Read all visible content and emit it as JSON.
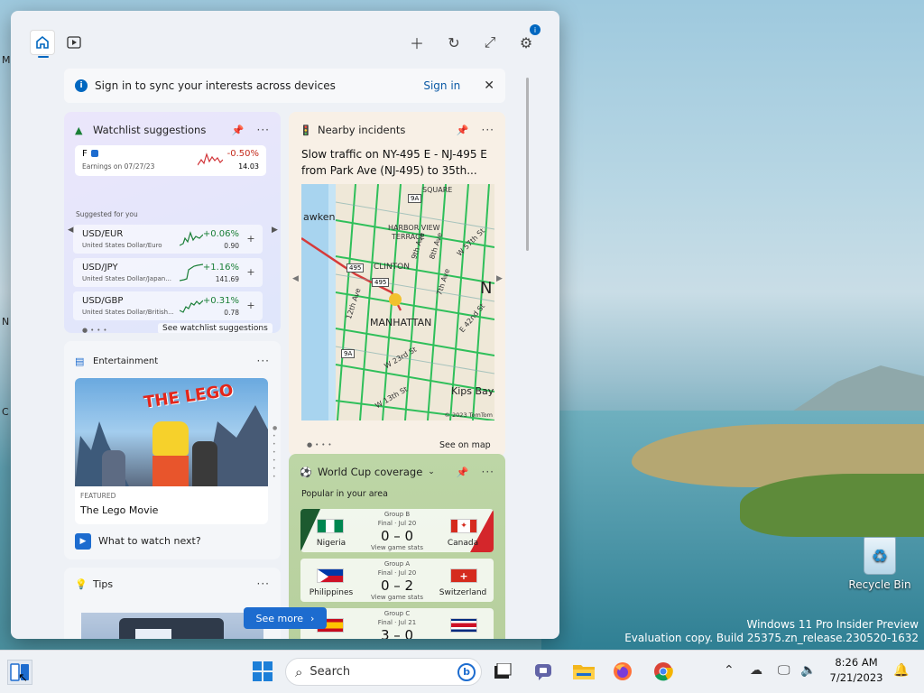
{
  "widgets_panel": {
    "sign_banner": {
      "text": "Sign in to sync your interests across devices",
      "link": "Sign in"
    },
    "watchlist": {
      "title": "Watchlist suggestions",
      "featured": {
        "symbol": "F",
        "subtitle": "Earnings on 07/27/23",
        "change": "-0.50%",
        "value": "14.03"
      },
      "suggested_label": "Suggested for you",
      "items": [
        {
          "symbol": "USD/EUR",
          "name": "United States Dollar/Euro",
          "change": "+0.06%",
          "value": "0.90"
        },
        {
          "symbol": "USD/JPY",
          "name": "United States Dollar/Japan...",
          "change": "+1.16%",
          "value": "141.69"
        },
        {
          "symbol": "USD/GBP",
          "name": "United States Dollar/British...",
          "change": "+0.31%",
          "value": "0.78"
        }
      ],
      "see_link": "See watchlist suggestions"
    },
    "entertainment": {
      "title": "Entertainment",
      "poster_text": "THE LEGO",
      "tag": "FEATURED",
      "movie": "The Lego Movie",
      "next": "What to watch next?"
    },
    "tips": {
      "title": "Tips"
    },
    "see_more": "See more",
    "nearby": {
      "title": "Nearby incidents",
      "headline": "Slow traffic on NY-495 E - NJ-495 E from Park Ave (NJ-495) to 35th...",
      "map_labels": {
        "hoboken": "awken",
        "harbor": "HARBOR VIEW",
        "terrace": "TERRACE",
        "clinton": "CLINTON",
        "manhattan": "MANHATTAN",
        "kips": "Kips Bay",
        "square": "SQUARE",
        "n": "N",
        "r495a": "495",
        "r495b": "495",
        "r9a": "9A",
        "r9a2": "9A",
        "ave12": "12th Ave",
        "ave9": "9th Ave",
        "ave8": "8th Ave",
        "ave7": "7th Ave",
        "st42": "E 42nd St",
        "st23": "W 23rd St",
        "st57": "W 57th St",
        "st13": "W 13th St",
        "copyright": "© 2023 TomTom"
      },
      "see_map": "See on map"
    },
    "worldcup": {
      "title": "World Cup coverage",
      "subtitle": "Popular in your area",
      "matches": [
        {
          "group": "Group B",
          "status": "Final · Jul 20",
          "score": "0 – 0",
          "home": "Nigeria",
          "away": "Canada",
          "stats": "View game stats"
        },
        {
          "group": "Group A",
          "status": "Final · Jul 20",
          "score": "0 – 2",
          "home": "Philippines",
          "away": "Switzerland",
          "stats": "View game stats"
        },
        {
          "group": "Group C",
          "status": "Final · Jul 21",
          "score": "3 – 0",
          "home": "",
          "away": ""
        }
      ]
    }
  },
  "desktop": {
    "recycle_bin": "Recycle Bin",
    "watermark_line1": "Windows 11 Pro Insider Preview",
    "watermark_line2": "Evaluation copy. Build 25375.zn_release.230520-1632"
  },
  "taskbar": {
    "search_placeholder": "Search",
    "time": "8:26 AM",
    "date": "7/21/2023"
  }
}
